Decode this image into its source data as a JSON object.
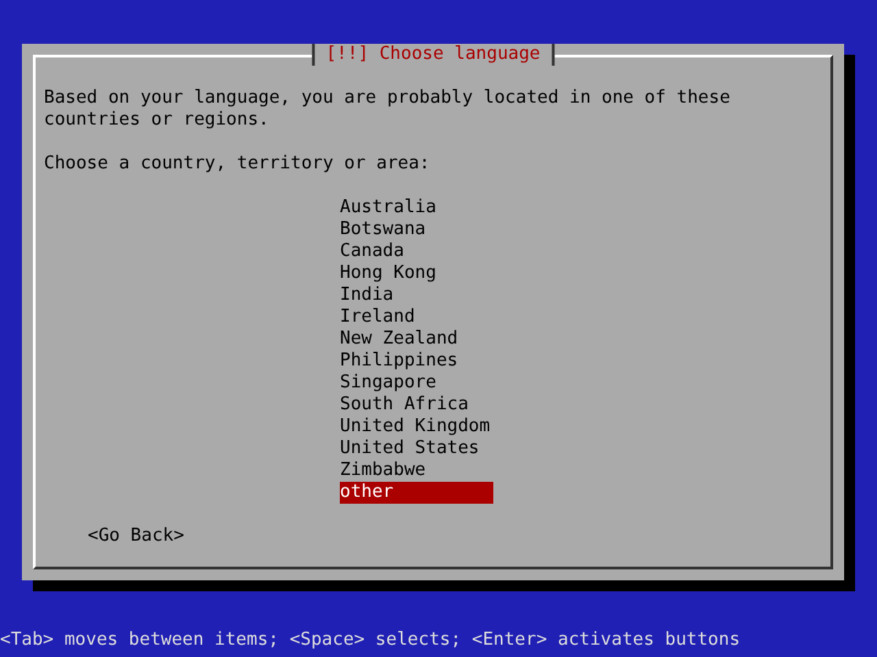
{
  "dialog": {
    "title": "[!!] Choose language",
    "message": "Based on your language, you are probably located in one of these countries or regions.",
    "prompt": "Choose a country, territory or area:",
    "options": [
      {
        "label": "Australia",
        "selected": false
      },
      {
        "label": "Botswana",
        "selected": false
      },
      {
        "label": "Canada",
        "selected": false
      },
      {
        "label": "Hong Kong",
        "selected": false
      },
      {
        "label": "India",
        "selected": false
      },
      {
        "label": "Ireland",
        "selected": false
      },
      {
        "label": "New Zealand",
        "selected": false
      },
      {
        "label": "Philippines",
        "selected": false
      },
      {
        "label": "Singapore",
        "selected": false
      },
      {
        "label": "South Africa",
        "selected": false
      },
      {
        "label": "United Kingdom",
        "selected": false
      },
      {
        "label": "United States",
        "selected": false
      },
      {
        "label": "Zimbabwe",
        "selected": false
      },
      {
        "label": "other",
        "selected": true
      }
    ],
    "back_button": "<Go Back>"
  },
  "help_line": "<Tab> moves between items; <Space> selects; <Enter> activates buttons"
}
